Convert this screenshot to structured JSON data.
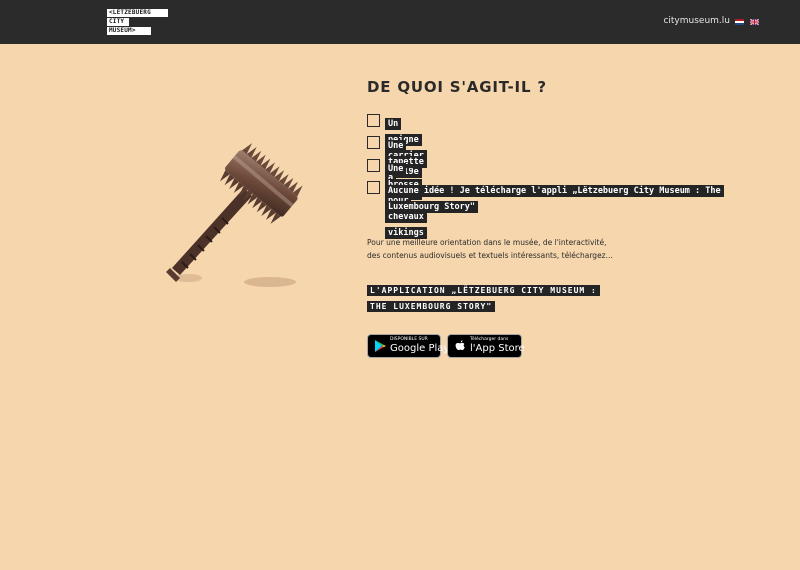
{
  "header": {
    "logo_lines": [
      "<LËTZEBUERG",
      "CITY",
      "MUSEUM>"
    ],
    "site_link": "citymuseum.lu",
    "flags": [
      "nl-flag-icon",
      "uk-flag-icon"
    ]
  },
  "artifact": {
    "icon": "iron-comb-artifact-image"
  },
  "quiz": {
    "title": "DE QUOI S'AGIT-IL ?",
    "options": [
      {
        "label": "Un peigne carrier du 19e",
        "checked": false
      },
      {
        "label": "Une tapette à mouche du 16e",
        "checked": false
      },
      {
        "label": "Une brosse pour chevaux vikings",
        "checked": false
      },
      {
        "label": "Aucune idée ! Je télécharge l'appli „Lëtzebuerg City Museum : The Luxembourg Story\"",
        "checked": false
      }
    ]
  },
  "info": {
    "text": "Pour une meilleure orientation dans le musée, de l'interactivité, des contenus audiovisuels et textuels intéressants, téléchargez...",
    "app_title": "L'APPLICATION „LËTZEBUERG CITY MUSEUM : THE LUXEMBOURG STORY\""
  },
  "stores": {
    "google": {
      "small": "DISPONIBLE SUR",
      "big": "Google Play",
      "icon": "google-play-icon"
    },
    "apple": {
      "small": "Télécharger dans",
      "big": "l'App Store",
      "icon": "apple-icon"
    }
  },
  "colors": {
    "background": "#f6d6ad",
    "header": "#2b2b2b",
    "label_bg": "#242424"
  }
}
